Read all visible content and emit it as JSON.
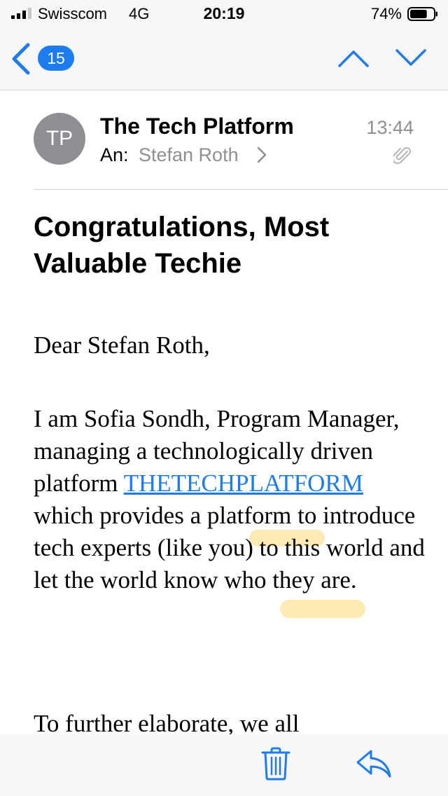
{
  "status_bar": {
    "carrier": "Swisscom",
    "network": "4G",
    "time": "20:19",
    "battery_percent": "74%",
    "battery_level": 0.74
  },
  "nav": {
    "back_count": "15"
  },
  "message": {
    "sender_initials": "TP",
    "sender_name": "The Tech Platform",
    "time": "13:44",
    "to_label": "An:",
    "to_name": "Stefan Roth",
    "subject": "Congratulations, Most Valuable Techie"
  },
  "body": {
    "greeting": "Dear Stefan Roth,",
    "para1_before": "I am Sofia Sondh, Program Manager, managing a technologically driven platform ",
    "para1_link": "THETECHPLATFORM",
    "para1_after": " which provides a platform to introduce tech experts (like you) to this world and let the world know who they are.",
    "para2": "To further elaborate, we all"
  },
  "colors": {
    "accent": "#1e7cf0",
    "secondary_text": "#8e8e93",
    "bar_background": "#f7f7f7"
  },
  "icons": {
    "back": "chevron-left-icon",
    "up": "chevron-up-icon",
    "down": "chevron-down-icon",
    "attachment": "paperclip-icon",
    "trash": "trash-icon",
    "reply": "reply-icon"
  }
}
